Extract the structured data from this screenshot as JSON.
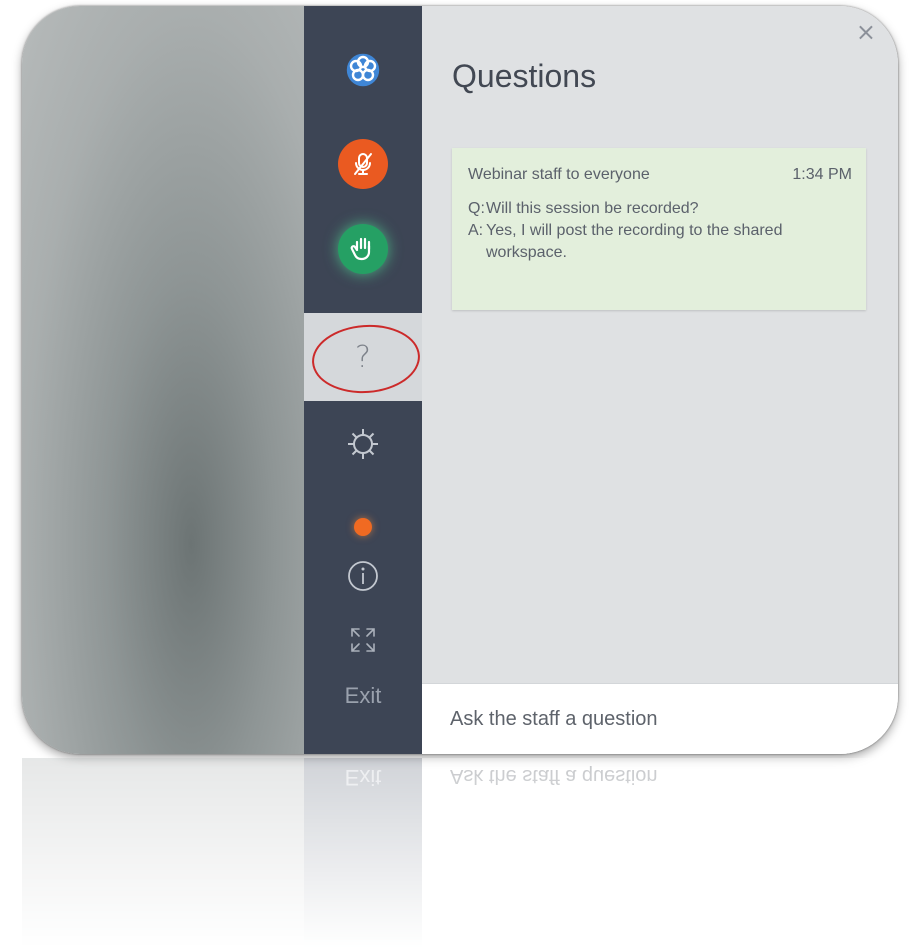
{
  "sidebar": {
    "help_label": "?",
    "exit_label": "Exit"
  },
  "panel": {
    "title": "Questions",
    "close_glyph": "×",
    "message": {
      "header": "Webinar staff to everyone",
      "time": "1:34 PM",
      "q_prefix": "Q:",
      "question": "Will this session be recorded?",
      "a_prefix": "A:",
      "answer": "Yes, I will post the recording to the shared workspace."
    },
    "input_placeholder": "Ask the staff a question"
  },
  "colors": {
    "rail": "#3d4555",
    "panel": "#dfe1e3",
    "message_bg": "#e3efdc",
    "mute": "#ea5a21",
    "hand": "#25a064",
    "status_dot": "#f06a22",
    "highlight_ring": "#cc2a2a"
  },
  "icons": [
    "app-logo-icon",
    "mic-muted-icon",
    "raise-hand-icon",
    "question-icon",
    "settings-gear-icon",
    "status-dot-icon",
    "info-icon",
    "fullscreen-icon",
    "close-icon"
  ]
}
